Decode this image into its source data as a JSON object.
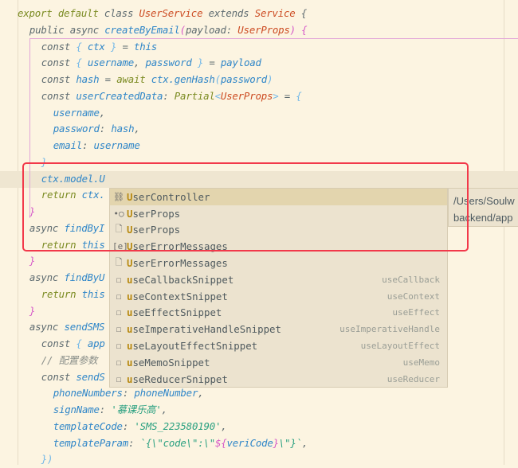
{
  "editor": {
    "lines": [
      {
        "indent": 0,
        "tokens": [
          [
            "export default ",
            "kw2"
          ],
          [
            "class ",
            "kw"
          ],
          [
            "UserService ",
            "cls"
          ],
          [
            "extends ",
            "kw"
          ],
          [
            "Service ",
            "cls"
          ],
          [
            "{",
            "pun"
          ]
        ]
      },
      {
        "indent": 2,
        "tokens": [
          [
            "public async ",
            "kw"
          ],
          [
            "createByEmail",
            "fn"
          ],
          [
            "(",
            "pk"
          ],
          [
            "payload",
            "kw"
          ],
          [
            ": ",
            "pun"
          ],
          [
            "UserProps",
            "cls"
          ],
          [
            ") ",
            "pk"
          ],
          [
            "{",
            "pk"
          ]
        ]
      },
      {
        "indent": 4,
        "tokens": [
          [
            "const ",
            "kw"
          ],
          [
            "{ ",
            "br"
          ],
          [
            "ctx ",
            "id"
          ],
          [
            "} ",
            "br"
          ],
          [
            "= ",
            "pun"
          ],
          [
            "this",
            "id"
          ]
        ]
      },
      {
        "indent": 4,
        "tokens": [
          [
            "const ",
            "kw"
          ],
          [
            "{ ",
            "br"
          ],
          [
            "username",
            "id"
          ],
          [
            ", ",
            "pun"
          ],
          [
            "password ",
            "id"
          ],
          [
            "} ",
            "br"
          ],
          [
            "= ",
            "pun"
          ],
          [
            "payload",
            "id"
          ]
        ]
      },
      {
        "indent": 4,
        "tokens": [
          [
            "const ",
            "kw"
          ],
          [
            "hash ",
            "id"
          ],
          [
            "= ",
            "pun"
          ],
          [
            "await ",
            "kw2"
          ],
          [
            "ctx.genHash",
            "id"
          ],
          [
            "(",
            "br"
          ],
          [
            "password",
            "id"
          ],
          [
            ")",
            "br"
          ]
        ]
      },
      {
        "indent": 4,
        "tokens": [
          [
            "const ",
            "kw"
          ],
          [
            "userCreatedData",
            "id"
          ],
          [
            ": ",
            "pun"
          ],
          [
            "Partial",
            "ty"
          ],
          [
            "<",
            "br"
          ],
          [
            "UserProps",
            "cls"
          ],
          [
            "> ",
            "br"
          ],
          [
            "= ",
            "pun"
          ],
          [
            "{",
            "br"
          ]
        ]
      },
      {
        "indent": 6,
        "tokens": [
          [
            "username",
            "id"
          ],
          [
            ",",
            "pun"
          ]
        ]
      },
      {
        "indent": 6,
        "tokens": [
          [
            "password",
            "id"
          ],
          [
            ": ",
            "pun"
          ],
          [
            "hash",
            "id"
          ],
          [
            ",",
            "pun"
          ]
        ]
      },
      {
        "indent": 6,
        "tokens": [
          [
            "email",
            "id"
          ],
          [
            ": ",
            "pun"
          ],
          [
            "username",
            "id"
          ]
        ]
      },
      {
        "indent": 4,
        "tokens": [
          [
            "}",
            "br"
          ]
        ]
      },
      {
        "indent": 4,
        "tokens": [
          [
            "ctx.model.U",
            "id"
          ]
        ]
      },
      {
        "indent": 4,
        "tokens": [
          [
            "return ",
            "kw2"
          ],
          [
            "ctx.",
            "id"
          ]
        ]
      },
      {
        "indent": 2,
        "tokens": [
          [
            "}",
            "pk"
          ]
        ]
      },
      {
        "indent": 2,
        "tokens": [
          [
            "async ",
            "kw"
          ],
          [
            "findByI",
            "fn"
          ]
        ]
      },
      {
        "indent": 4,
        "tokens": [
          [
            "return ",
            "kw2"
          ],
          [
            "this",
            "id"
          ]
        ]
      },
      {
        "indent": 2,
        "tokens": [
          [
            "}",
            "pk"
          ]
        ]
      },
      {
        "indent": 2,
        "tokens": [
          [
            "async ",
            "kw"
          ],
          [
            "findByU",
            "fn"
          ]
        ]
      },
      {
        "indent": 4,
        "tokens": [
          [
            "return ",
            "kw2"
          ],
          [
            "this",
            "id"
          ]
        ]
      },
      {
        "indent": 2,
        "tokens": [
          [
            "}",
            "pk"
          ]
        ]
      },
      {
        "indent": 2,
        "tokens": [
          [
            "async ",
            "kw"
          ],
          [
            "sendSMS",
            "fn"
          ]
        ]
      },
      {
        "indent": 4,
        "tokens": [
          [
            "const ",
            "kw"
          ],
          [
            "{ ",
            "br"
          ],
          [
            "app",
            "id"
          ]
        ]
      },
      {
        "indent": 4,
        "tokens": [
          [
            "// 配置参数",
            "cm"
          ]
        ]
      },
      {
        "indent": 4,
        "tokens": [
          [
            "const ",
            "kw"
          ],
          [
            "sendS",
            "fn"
          ]
        ]
      },
      {
        "indent": 6,
        "tokens": [
          [
            "phoneNumbers",
            "id"
          ],
          [
            ": ",
            "pun"
          ],
          [
            "phoneNumber",
            "id"
          ],
          [
            ",",
            "pun"
          ]
        ]
      },
      {
        "indent": 6,
        "tokens": [
          [
            "signName",
            "id"
          ],
          [
            ": ",
            "pun"
          ],
          [
            "'慕课乐高'",
            "str"
          ],
          [
            ",",
            "pun"
          ]
        ]
      },
      {
        "indent": 6,
        "tokens": [
          [
            "templateCode",
            "id"
          ],
          [
            ": ",
            "pun"
          ],
          [
            "'SMS_223580190'",
            "str"
          ],
          [
            ",",
            "pun"
          ]
        ]
      },
      {
        "indent": 6,
        "tokens": [
          [
            "templateParam",
            "id"
          ],
          [
            ": ",
            "pun"
          ],
          [
            "`{\\\"code\\\":\\\"",
            "str"
          ],
          [
            "${",
            "pk"
          ],
          [
            "veriCode",
            "id"
          ],
          [
            "}",
            "pk"
          ],
          [
            "\\\"}`",
            "str"
          ],
          [
            ",",
            "pun"
          ]
        ]
      },
      {
        "indent": 4,
        "tokens": [
          [
            "})",
            "br"
          ]
        ]
      }
    ]
  },
  "completion": {
    "typed_prefix_char": "U",
    "items": [
      {
        "match": "U",
        "rest": "serController",
        "icon": "controller-icon",
        "glyph": "⛓",
        "tail": "",
        "selected": true
      },
      {
        "match": "U",
        "rest": "serProps",
        "icon": "interface-icon",
        "glyph": "•○",
        "tail": ""
      },
      {
        "match": "U",
        "rest": "serProps",
        "icon": "type-file-icon",
        "glyph": "🗋",
        "tail": ""
      },
      {
        "match": "U",
        "rest": "serErrorMessages",
        "icon": "enum-icon",
        "glyph": "[e]",
        "tail": ""
      },
      {
        "match": "U",
        "rest": "serErrorMessages",
        "icon": "type-file-icon",
        "glyph": "🗋",
        "tail": ""
      },
      {
        "match": "u",
        "rest": "seCallbackSnippet",
        "icon": "snippet-icon",
        "glyph": "☐",
        "tail": "useCallback"
      },
      {
        "match": "u",
        "rest": "seContextSnippet",
        "icon": "snippet-icon",
        "glyph": "☐",
        "tail": "useContext"
      },
      {
        "match": "u",
        "rest": "seEffectSnippet",
        "icon": "snippet-icon",
        "glyph": "☐",
        "tail": "useEffect"
      },
      {
        "match": "u",
        "rest": "seImperativeHandleSnippet",
        "icon": "snippet-icon",
        "glyph": "☐",
        "tail": "useImperativeHandle"
      },
      {
        "match": "u",
        "rest": "seLayoutEffectSnippet",
        "icon": "snippet-icon",
        "glyph": "☐",
        "tail": "useLayoutEffect"
      },
      {
        "match": "u",
        "rest": "seMemoSnippet",
        "icon": "snippet-icon",
        "glyph": "☐",
        "tail": "useMemo"
      },
      {
        "match": "u",
        "rest": "seReducerSnippet",
        "icon": "snippet-icon",
        "glyph": "☐",
        "tail": "useReducer"
      }
    ]
  },
  "tooltip": {
    "line1": "/Users/Soulw",
    "line2": "backend/app"
  },
  "colors": {
    "background": "#fcf4e1",
    "highlight_box": "#f2394a",
    "selected_item": "#e3d5ae"
  }
}
